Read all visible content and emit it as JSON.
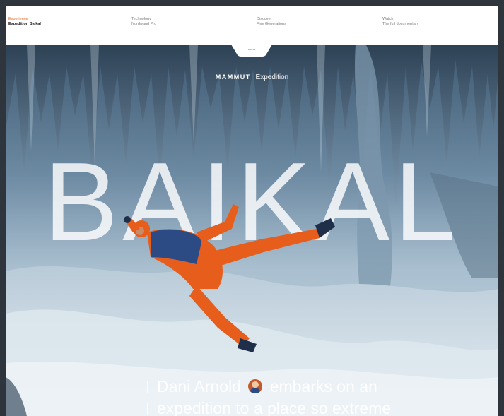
{
  "nav": {
    "items": [
      {
        "kicker": "Experience",
        "title": "Expedition Baikal",
        "active": true
      },
      {
        "kicker": "Technology",
        "title": "Nordwand Pro",
        "active": false
      },
      {
        "kicker": "Discover",
        "title": "Five Generations",
        "active": false
      },
      {
        "kicker": "Watch",
        "title": "The full documentary",
        "active": false
      }
    ],
    "notch_label": "menu"
  },
  "hero": {
    "brand_logo": "MAMMUT",
    "brand_sub": "Expedition",
    "big_title": "BAIKAL",
    "intro_line1_a": "Dani Arnold",
    "intro_line1_b": "embarks on an",
    "intro_line2": "expedition to a place so extreme"
  },
  "colors": {
    "accent": "#e8641e",
    "ice": "#8fa9bb",
    "jacket_orange": "#e65d1c",
    "jacket_blue": "#2c4b85"
  },
  "icons": {
    "avatar": "person-avatar-icon"
  }
}
